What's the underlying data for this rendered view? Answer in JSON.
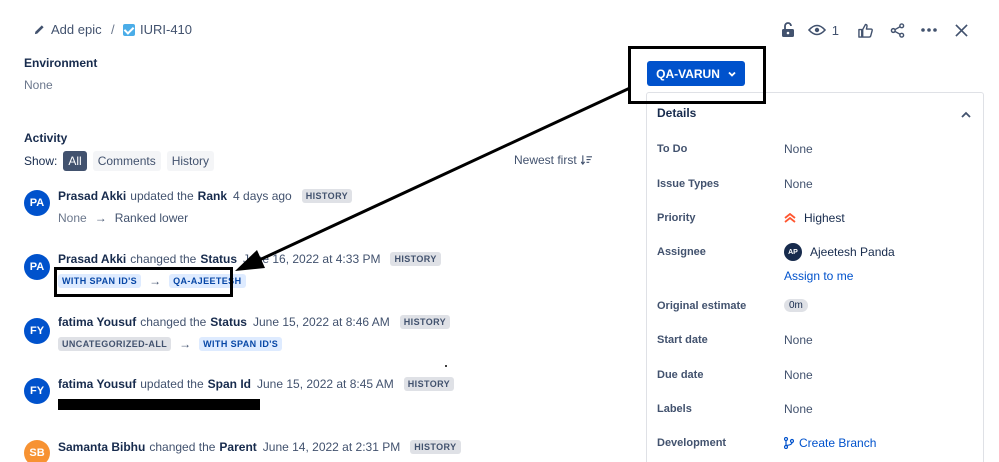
{
  "breadcrumb": {
    "add_epic": "Add epic",
    "separator": "/",
    "issue_key": "IURI-410"
  },
  "toolbar": {
    "watch_count": "1"
  },
  "environment": {
    "title": "Environment",
    "value": "None"
  },
  "activity": {
    "title": "Activity",
    "show_label": "Show:",
    "filters": [
      "All",
      "Comments",
      "History"
    ],
    "sort_label": "Newest first",
    "history_tag": "HISTORY",
    "entries": [
      {
        "initials": "PA",
        "color": "#0052cc",
        "user": "Prasad Akki",
        "action": "updated the",
        "field": "Rank",
        "time": "4 days ago",
        "from": "None",
        "to": "Ranked lower"
      },
      {
        "initials": "PA",
        "color": "#0052cc",
        "user": "Prasad Akki",
        "action": "changed the",
        "field": "Status",
        "time": "June 16, 2022 at 4:33 PM",
        "from": "WITH SPAN ID'S",
        "to": "QA-AJEETESH"
      },
      {
        "initials": "FY",
        "color": "#0052cc",
        "user": "fatima Yousuf",
        "action": "changed the",
        "field": "Status",
        "time": "June 15, 2022 at 8:46 AM",
        "from": "UNCATEGORIZED-ALL",
        "to": "WITH SPAN ID'S"
      },
      {
        "initials": "FY",
        "color": "#0052cc",
        "user": "fatima Yousuf",
        "action": "updated the",
        "field": "Span Id",
        "time": "June 15, 2022 at 8:45 AM"
      },
      {
        "initials": "SB",
        "color": "#f79232",
        "user": "Samanta Bibhu",
        "action": "changed the",
        "field": "Parent",
        "time": "June 14, 2022 at 2:31 PM"
      }
    ]
  },
  "status_button": {
    "label": "QA-VARUN"
  },
  "details": {
    "title": "Details",
    "rows": [
      {
        "label": "To Do",
        "value": "None"
      },
      {
        "label": "Issue Types",
        "value": "None"
      },
      {
        "label": "Priority",
        "value": "Highest"
      },
      {
        "label": "Assignee",
        "value": "Ajeetesh Panda",
        "initials": "AP",
        "link": "Assign to me"
      },
      {
        "label": "Original estimate",
        "value": "0m"
      },
      {
        "label": "Start date",
        "value": "None"
      },
      {
        "label": "Due date",
        "value": "None"
      },
      {
        "label": "Labels",
        "value": "None"
      },
      {
        "label": "Development",
        "value": "Create Branch"
      }
    ]
  },
  "colors": {
    "primary": "#0052cc",
    "priority_highest": "#ff5630",
    "annotation": "#000000"
  }
}
